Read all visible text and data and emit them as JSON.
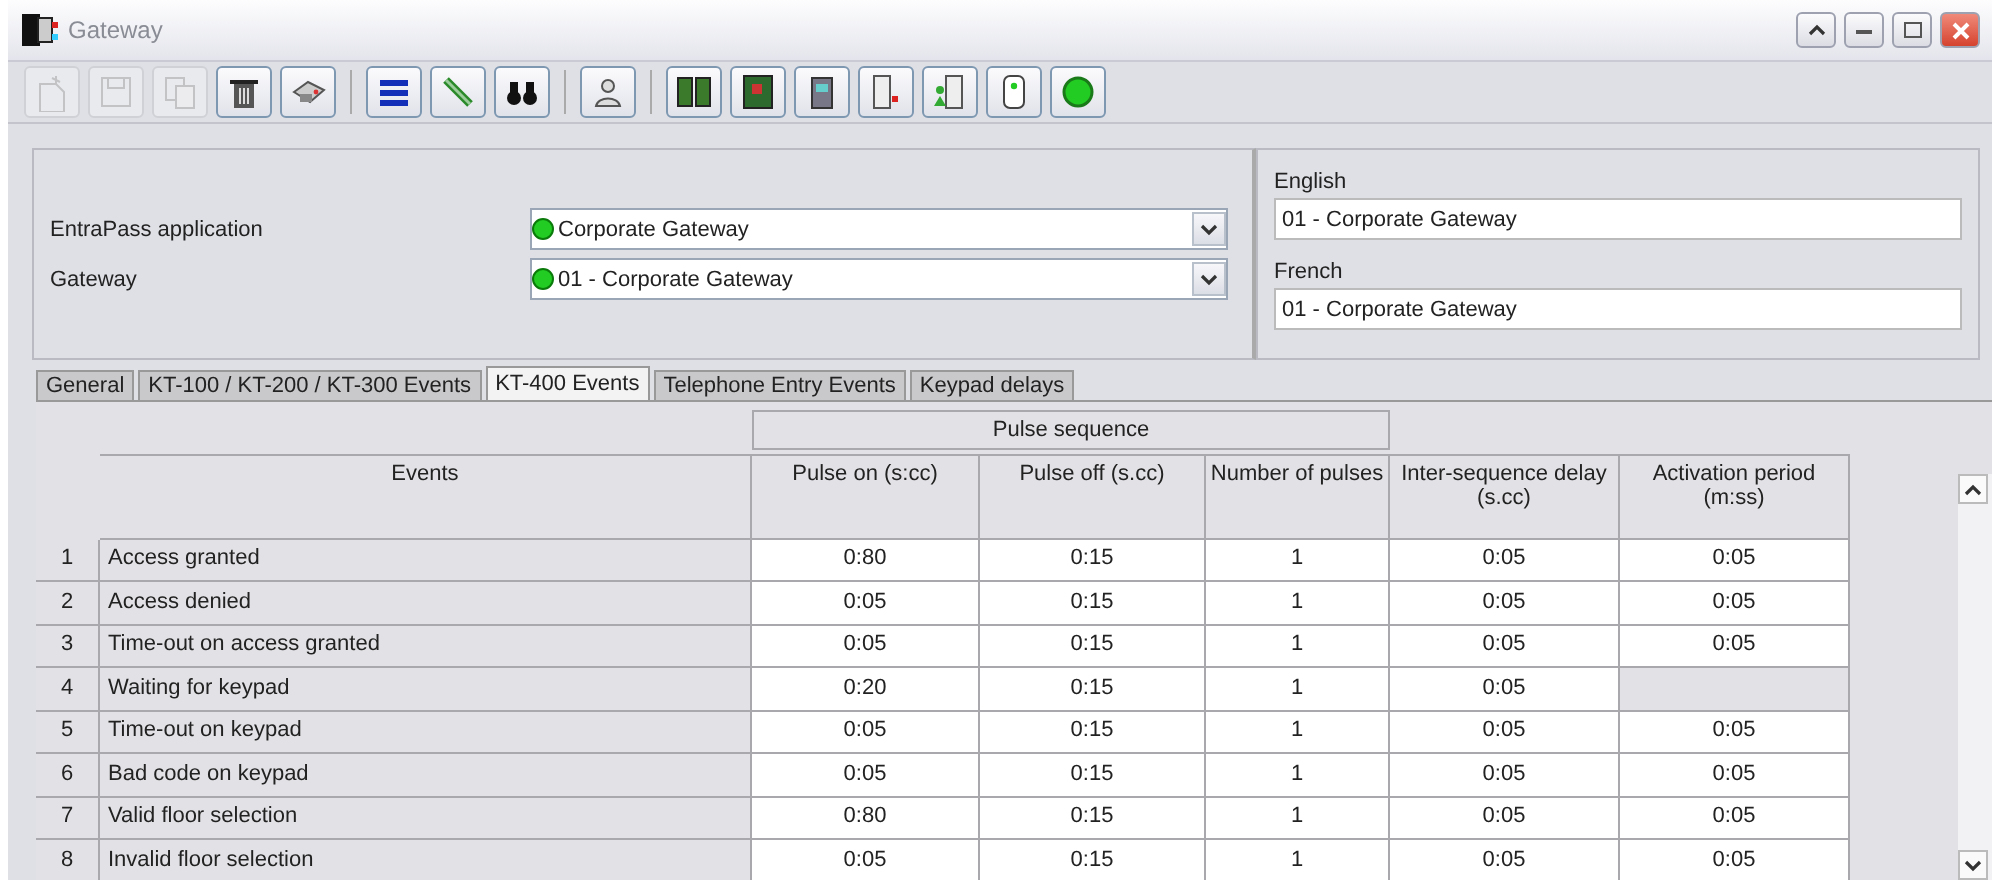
{
  "window": {
    "title": "Gateway"
  },
  "toolbar": {
    "groups": [
      [
        {
          "disabled": true
        },
        {
          "disabled": true
        },
        {
          "disabled": true
        },
        {
          "disabled": false
        },
        {
          "disabled": false
        }
      ],
      [
        {
          "disabled": false
        },
        {
          "disabled": false
        },
        {
          "disabled": false
        }
      ],
      [
        {
          "disabled": false
        }
      ],
      [
        {
          "disabled": false
        },
        {
          "disabled": false
        },
        {
          "disabled": false
        },
        {
          "disabled": false
        },
        {
          "disabled": false
        },
        {
          "disabled": false
        },
        {
          "disabled": false
        }
      ]
    ]
  },
  "form": {
    "fields": [
      {
        "label": "EntraPass application",
        "value": "Corporate Gateway"
      },
      {
        "label": "Gateway",
        "value": "01 - Corporate Gateway"
      }
    ],
    "languages": [
      {
        "label": "English",
        "value": "01 - Corporate Gateway"
      },
      {
        "label": "French",
        "value": "01 - Corporate Gateway"
      }
    ]
  },
  "tabs": [
    {
      "label": "General",
      "selected": false
    },
    {
      "label": "KT-100 / KT-200 / KT-300 Events",
      "selected": false
    },
    {
      "label": "KT-400 Events",
      "selected": true
    },
    {
      "label": "Telephone Entry Events",
      "selected": false
    },
    {
      "label": "Keypad delays",
      "selected": false
    }
  ],
  "table": {
    "group_header": "Pulse sequence",
    "columns": [
      "Events",
      "Pulse on (s:cc)",
      "Pulse off (s.cc)",
      "Number of pulses",
      "Inter-sequence delay (s.cc)",
      "Activation period (m:ss)"
    ],
    "rows": [
      {
        "index": "1",
        "event": "Access granted",
        "pulse_on": "0:80",
        "pulse_off": "0:15",
        "pulses": "1",
        "inter_delay": "0:05",
        "activation": "0:05"
      },
      {
        "index": "2",
        "event": "Access denied",
        "pulse_on": "0:05",
        "pulse_off": "0:15",
        "pulses": "1",
        "inter_delay": "0:05",
        "activation": "0:05"
      },
      {
        "index": "3",
        "event": "Time-out on access granted",
        "pulse_on": "0:05",
        "pulse_off": "0:15",
        "pulses": "1",
        "inter_delay": "0:05",
        "activation": "0:05"
      },
      {
        "index": "4",
        "event": "Waiting for keypad",
        "pulse_on": "0:20",
        "pulse_off": "0:15",
        "pulses": "1",
        "inter_delay": "0:05"
      },
      {
        "index": "5",
        "event": "Time-out on keypad",
        "pulse_on": "0:05",
        "pulse_off": "0:15",
        "pulses": "1",
        "inter_delay": "0:05",
        "activation": "0:05"
      },
      {
        "index": "6",
        "event": "Bad code on keypad",
        "pulse_on": "0:05",
        "pulse_off": "0:15",
        "pulses": "1",
        "inter_delay": "0:05",
        "activation": "0:05"
      },
      {
        "index": "7",
        "event": "Valid floor selection",
        "pulse_on": "0:80",
        "pulse_off": "0:15",
        "pulses": "1",
        "inter_delay": "0:05",
        "activation": "0:05"
      },
      {
        "index": "8",
        "event": "Invalid floor selection",
        "pulse_on": "0:05",
        "pulse_off": "0:15",
        "pulses": "1",
        "inter_delay": "0:05",
        "activation": "0:05"
      }
    ]
  }
}
